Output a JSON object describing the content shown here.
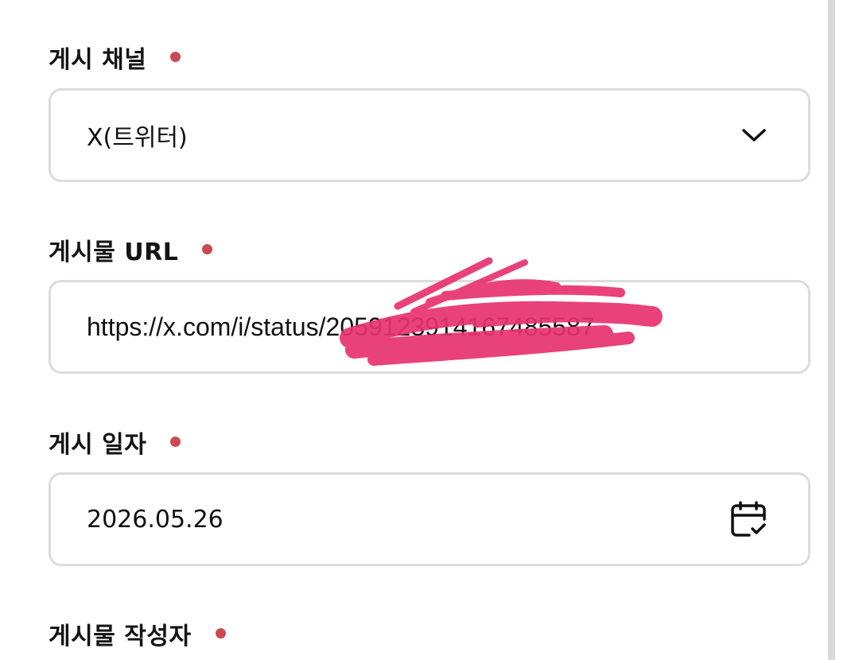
{
  "form": {
    "channel": {
      "label": "게시 채널",
      "value": "X(트위터)",
      "icon": "chevron-down-icon"
    },
    "post_url": {
      "label": "게시물 URL",
      "value": "https://x.com/i/status/2059123914167485587"
    },
    "post_date": {
      "label": "게시 일자",
      "value": "2026.05.26",
      "icon": "calendar-check-icon"
    },
    "author": {
      "label": "게시물 작성자"
    }
  },
  "colors": {
    "required_dot": "#cb4a52",
    "border": "#dcdcdc",
    "redaction": "#e8336f"
  }
}
